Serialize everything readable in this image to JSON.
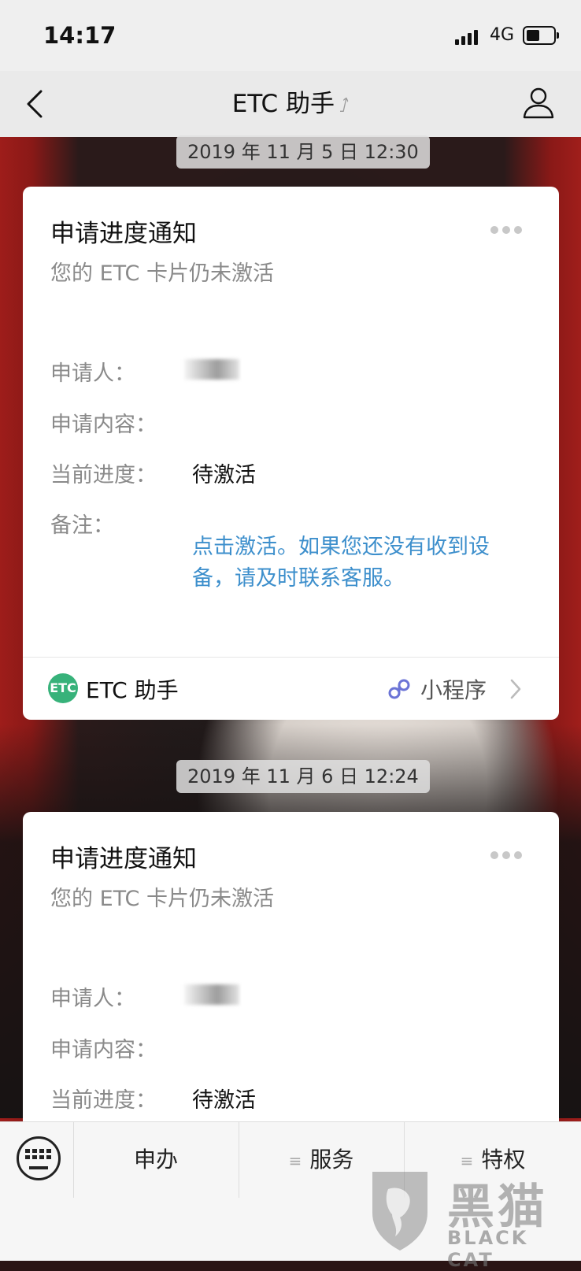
{
  "status_bar": {
    "time": "14:17",
    "network": "4G",
    "signal_bars": 4,
    "battery_level": 0.5
  },
  "nav": {
    "title": "ETC 助手",
    "back_icon": "chevron-left-icon",
    "ear_icon": "ear-icon",
    "profile_icon": "person-icon"
  },
  "messages": [
    {
      "timestamp": "2019 年 11 月 5 日  12:30",
      "card": {
        "title": "申请进度通知",
        "subtitle": "您的 ETC 卡片仍未激活",
        "rows": [
          {
            "label": "申请人：",
            "value": ""
          },
          {
            "label": "申请内容：",
            "value": ""
          },
          {
            "label": "当前进度：",
            "value": "待激活"
          },
          {
            "label": "备注：",
            "value": "点击激活。如果您还没有收到设备，请及时联系客服。"
          }
        ],
        "footer": {
          "app_name": "ETC 助手",
          "mini_program_label": "小程序"
        }
      }
    },
    {
      "timestamp": "2019 年 11 月 6 日  12:24",
      "card": {
        "title": "申请进度通知",
        "subtitle": "您的 ETC 卡片仍未激活",
        "rows": [
          {
            "label": "申请人：",
            "value": ""
          },
          {
            "label": "申请内容：",
            "value": ""
          },
          {
            "label": "当前进度：",
            "value": "待激活"
          }
        ]
      }
    }
  ],
  "bottom_menu": {
    "items": [
      "申办",
      "服务",
      "特权"
    ]
  },
  "watermark": {
    "text_cn": "黑猫",
    "text_en": "BLACK CAT"
  },
  "colors": {
    "link_blue": "#3d8fcc",
    "app_green": "#37b27a"
  }
}
